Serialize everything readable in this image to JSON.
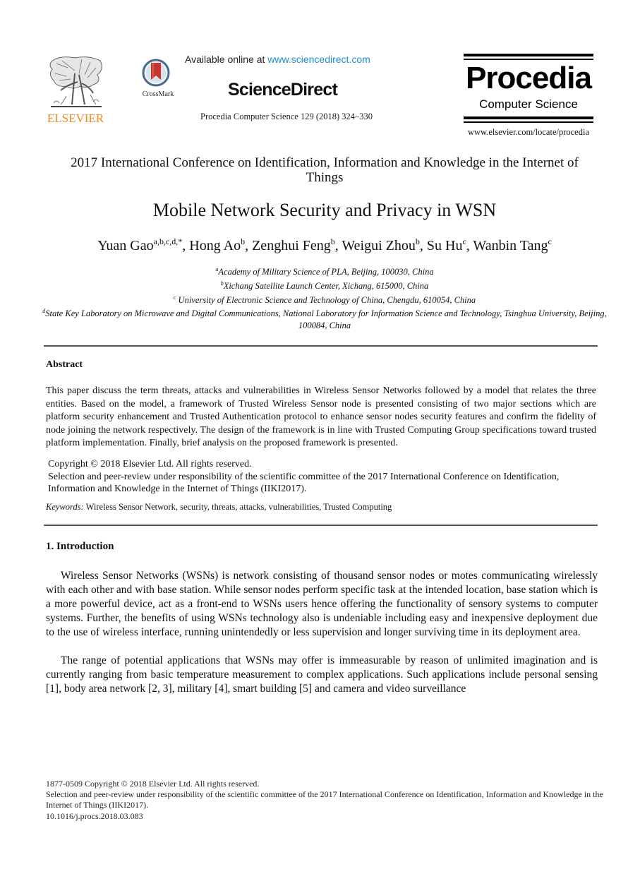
{
  "header": {
    "publisher_logo_text": "ELSEVIER",
    "crossmark_label": "CrossMark",
    "available_prefix": "Available online at ",
    "available_link": "www.sciencedirect.com",
    "brand": "ScienceDirect",
    "journal_reference": "Procedia Computer Science 129 (2018) 324–330",
    "journal_logo_title": "Procedia",
    "journal_logo_subtitle": "Computer Science",
    "journal_url": "www.elsevier.com/locate/procedia",
    "colors": {
      "elsevier_orange": "#f08a1c",
      "link_blue": "#1a8fd0",
      "crossmark_red": "#c0392b"
    }
  },
  "conference": "2017 International Conference on Identification, Information and Knowledge in the Internet of Things",
  "title": "Mobile Network Security and Privacy in WSN",
  "authors": [
    {
      "name": "Yuan Gao",
      "sup": "a,b,c,d,*"
    },
    {
      "name": "Hong Ao",
      "sup": "b"
    },
    {
      "name": "Zenghui Feng",
      "sup": "b"
    },
    {
      "name": "Weigui Zhou",
      "sup": "b"
    },
    {
      "name": "Su Hu",
      "sup": "c"
    },
    {
      "name": "Wanbin Tang",
      "sup": "c"
    }
  ],
  "affiliations": [
    {
      "sup": "a",
      "text": "Academy of Military Science of PLA, Beijing, 100030, China"
    },
    {
      "sup": "b",
      "text": "Xichang Satellite Launch Center, Xichang, 615000, China"
    },
    {
      "sup": "c",
      "text": " University of Electronic Science and Technology of China, Chengdu, 610054, China"
    },
    {
      "sup": "d",
      "text": "State Key Laboratory on Microwave and Digital Communications, National Laboratory for Information Science and Technology, Tsinghua University, Beijing, 100084, China"
    }
  ],
  "abstract": {
    "heading": "Abstract",
    "text": "This paper discuss the term threats, attacks and vulnerabilities in Wireless Sensor Networks followed by a model that relates the three entities. Based on the model, a framework of Trusted Wireless Sensor node is presented consisting of two major sections which are platform security enhancement and Trusted Authentication protocol to enhance sensor nodes security features and confirm the fidelity of node joining the network respectively. The design of the framework is in line with Trusted Computing Group specifications toward trusted platform implementation. Finally, brief analysis on the proposed framework is presented.",
    "copyright": "Copyright © 2018 Elsevier Ltd. All rights reserved.",
    "review_note": "Selection and peer-review under responsibility of the scientific committee of the 2017 International Conference on Identification, Information and Knowledge in the Internet of Things (IIKI2017).",
    "keywords_label": "Keywords:",
    "keywords": " Wireless Sensor Network, security, threats, attacks, vulnerabilities, Trusted Computing"
  },
  "introduction": {
    "heading": "1. Introduction",
    "paragraphs": [
      "Wireless Sensor Networks (WSNs) is network consisting of thousand sensor nodes or motes communicating wirelessly with each other and with base station. While sensor nodes perform specific task at the intended location, base station which is a more powerful device, act as a front-end to WSNs users hence offering the functionality of sensory systems to computer systems. Further, the benefits of using WSNs technology also is undeniable including easy and inexpensive deployment due to the use of wireless interface, running unintendedly or less supervision and longer surviving time in its deployment area.",
      "The range of potential applications that WSNs may offer is immeasurable by reason of unlimited imagination and is currently ranging from basic temperature measurement to complex applications. Such applications include personal sensing [1], body area network [2, 3], military [4], smart building [5] and camera and video surveillance"
    ]
  },
  "footer": {
    "issn_copyright": "1877-0509 Copyright © 2018 Elsevier Ltd. All rights reserved.",
    "review_note": "Selection and peer-review under responsibility of the scientific committee of the 2017 International Conference on Identification, Information and Knowledge in the Internet of Things (IIKI2017).",
    "doi": "10.1016/j.procs.2018.03.083"
  }
}
